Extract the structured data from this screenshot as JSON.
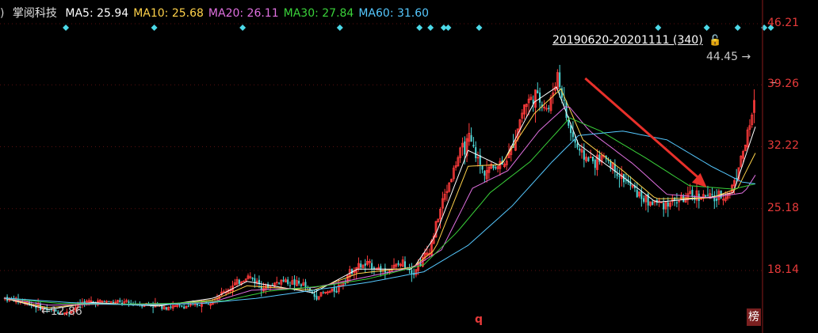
{
  "stock": {
    "name": "掌阅科技",
    "prefix": ")"
  },
  "indicators": [
    {
      "label": "MA5",
      "value": "25.94",
      "color": "#ffffff"
    },
    {
      "label": "MA10",
      "value": "25.68",
      "color": "#ffd24a"
    },
    {
      "label": "MA20",
      "value": "26.11",
      "color": "#e070e0"
    },
    {
      "label": "MA30",
      "value": "27.84",
      "color": "#3ad23a"
    },
    {
      "label": "MA60",
      "value": "31.60",
      "color": "#55c8ff"
    }
  ],
  "range_label": "20190620-20201111 (340)",
  "lock_icon": "unlock-icon",
  "max_label": "44.45",
  "max_arrow": "→",
  "min_label": "12.86",
  "min_arrow": "←",
  "bottom_marker": "q",
  "list_badge": "榜",
  "colors": {
    "up": "#ff3b3b",
    "down": "#4cd9d9",
    "axis": "#8a1c1c",
    "grid": "#5a1010",
    "marker": "#4cd9e8",
    "trend_arrow": "#e8302a"
  },
  "chart_data": {
    "type": "candlestick",
    "period": "20190620-20201111",
    "bar_count": 340,
    "y_ticks": [
      46.21,
      39.26,
      32.22,
      25.18,
      18.14
    ],
    "ylim": [
      11.0,
      47.5
    ],
    "max_price": 44.45,
    "min_price": 12.86,
    "close_path": [
      [
        0,
        15.0
      ],
      [
        10,
        14.5
      ],
      [
        20,
        13.6
      ],
      [
        28,
        13.3
      ],
      [
        35,
        14.5
      ],
      [
        45,
        14.6
      ],
      [
        55,
        14.4
      ],
      [
        65,
        14.3
      ],
      [
        75,
        14.0
      ],
      [
        85,
        14.1
      ],
      [
        95,
        15.0
      ],
      [
        110,
        17.5
      ],
      [
        118,
        16.2
      ],
      [
        125,
        17.0
      ],
      [
        135,
        16.5
      ],
      [
        140,
        15.2
      ],
      [
        150,
        16.0
      ],
      [
        158,
        18.5
      ],
      [
        165,
        18.8
      ],
      [
        172,
        18.0
      ],
      [
        180,
        19.0
      ],
      [
        185,
        18.0
      ],
      [
        192,
        20.5
      ],
      [
        198,
        26.0
      ],
      [
        205,
        31.0
      ],
      [
        210,
        33.0
      ],
      [
        216,
        29.5
      ],
      [
        222,
        30.0
      ],
      [
        228,
        31.0
      ],
      [
        235,
        37.0
      ],
      [
        240,
        38.0
      ],
      [
        246,
        36.5
      ],
      [
        250,
        40.5
      ],
      [
        255,
        34.5
      ],
      [
        260,
        31.5
      ],
      [
        266,
        30.5
      ],
      [
        272,
        31.0
      ],
      [
        278,
        29.0
      ],
      [
        284,
        27.5
      ],
      [
        290,
        26.0
      ],
      [
        298,
        25.8
      ],
      [
        306,
        26.2
      ],
      [
        314,
        26.7
      ],
      [
        322,
        26.3
      ],
      [
        328,
        27.0
      ],
      [
        332,
        30.0
      ],
      [
        336,
        33.5
      ],
      [
        340,
        38.0
      ]
    ],
    "ma_path": {
      "MA5": [
        [
          0,
          15.0
        ],
        [
          20,
          13.7
        ],
        [
          40,
          14.5
        ],
        [
          70,
          14.1
        ],
        [
          95,
          15.0
        ],
        [
          110,
          16.9
        ],
        [
          140,
          15.6
        ],
        [
          160,
          18.3
        ],
        [
          185,
          18.3
        ],
        [
          195,
          22.0
        ],
        [
          210,
          31.8
        ],
        [
          225,
          30.0
        ],
        [
          240,
          37.3
        ],
        [
          250,
          39.0
        ],
        [
          260,
          32.5
        ],
        [
          280,
          28.8
        ],
        [
          295,
          25.9
        ],
        [
          320,
          26.5
        ],
        [
          330,
          27.0
        ],
        [
          340,
          34.5
        ]
      ],
      "MA10": [
        [
          0,
          15.0
        ],
        [
          20,
          13.9
        ],
        [
          40,
          14.4
        ],
        [
          70,
          14.2
        ],
        [
          95,
          14.8
        ],
        [
          110,
          16.4
        ],
        [
          140,
          15.9
        ],
        [
          160,
          17.8
        ],
        [
          185,
          18.5
        ],
        [
          195,
          20.5
        ],
        [
          210,
          30.0
        ],
        [
          225,
          30.2
        ],
        [
          240,
          36.0
        ],
        [
          252,
          38.8
        ],
        [
          262,
          33.0
        ],
        [
          280,
          29.5
        ],
        [
          295,
          26.3
        ],
        [
          320,
          26.4
        ],
        [
          332,
          27.5
        ],
        [
          340,
          31.5
        ]
      ],
      "MA20": [
        [
          0,
          15.0
        ],
        [
          20,
          14.2
        ],
        [
          45,
          14.3
        ],
        [
          70,
          14.3
        ],
        [
          95,
          14.6
        ],
        [
          112,
          15.9
        ],
        [
          140,
          16.2
        ],
        [
          160,
          17.2
        ],
        [
          185,
          18.5
        ],
        [
          198,
          20.5
        ],
        [
          212,
          27.5
        ],
        [
          228,
          29.5
        ],
        [
          242,
          34.0
        ],
        [
          255,
          37.0
        ],
        [
          265,
          34.0
        ],
        [
          285,
          30.2
        ],
        [
          300,
          26.8
        ],
        [
          320,
          26.4
        ],
        [
          335,
          27.0
        ],
        [
          340,
          29.0
        ]
      ],
      "MA30": [
        [
          0,
          15.0
        ],
        [
          25,
          14.4
        ],
        [
          50,
          14.3
        ],
        [
          75,
          14.4
        ],
        [
          100,
          14.7
        ],
        [
          120,
          15.8
        ],
        [
          145,
          16.4
        ],
        [
          165,
          17.2
        ],
        [
          190,
          18.8
        ],
        [
          205,
          22.5
        ],
        [
          220,
          27.0
        ],
        [
          238,
          30.5
        ],
        [
          256,
          35.5
        ],
        [
          270,
          34.0
        ],
        [
          290,
          31.0
        ],
        [
          310,
          27.8
        ],
        [
          330,
          27.4
        ],
        [
          340,
          28.0
        ]
      ],
      "MA60": [
        [
          0,
          15.0
        ],
        [
          30,
          14.5
        ],
        [
          60,
          14.2
        ],
        [
          90,
          14.4
        ],
        [
          115,
          15.0
        ],
        [
          140,
          15.9
        ],
        [
          165,
          16.8
        ],
        [
          190,
          18.0
        ],
        [
          210,
          21.0
        ],
        [
          230,
          25.5
        ],
        [
          248,
          30.5
        ],
        [
          260,
          33.5
        ],
        [
          280,
          34.0
        ],
        [
          300,
          33.0
        ],
        [
          320,
          30.0
        ],
        [
          334,
          28.2
        ],
        [
          340,
          28.0
        ]
      ]
    },
    "signal_markers_x": [
      28,
      68,
      108,
      152,
      188,
      193,
      199,
      201,
      215,
      296,
      318,
      332,
      344,
      347
    ],
    "trend_arrow": {
      "from": [
        263,
        40.0
      ],
      "to": [
        318,
        27.6
      ]
    }
  }
}
